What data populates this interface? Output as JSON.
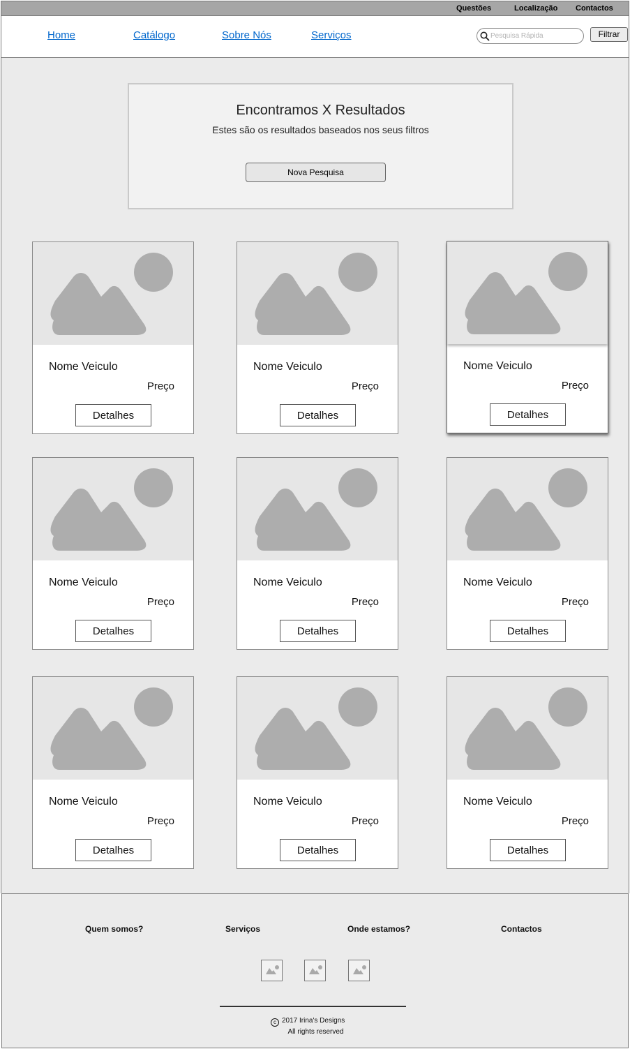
{
  "utility_nav": [
    "Questões",
    "Localização",
    "Contactos"
  ],
  "main_nav": [
    "Home",
    "Catálogo",
    "Sobre Nós",
    "Serviços"
  ],
  "search": {
    "placeholder": "Pesquisa Rápida",
    "button": "Filtrar"
  },
  "results": {
    "title": "Encontramos X Resultados",
    "subtitle": "Estes são os resultados baseados nos seus filtros",
    "button": "Nova Pesquisa"
  },
  "cards": [
    {
      "name": "Nome Veiculo",
      "price": "Preço",
      "button": "Detalhes"
    },
    {
      "name": "Nome Veiculo",
      "price": "Preço",
      "button": "Detalhes"
    },
    {
      "name": "Nome Veiculo",
      "price": "Preço",
      "button": "Detalhes"
    },
    {
      "name": "Nome Veiculo",
      "price": "Preço",
      "button": "Detalhes"
    },
    {
      "name": "Nome Veiculo",
      "price": "Preço",
      "button": "Detalhes"
    },
    {
      "name": "Nome Veiculo",
      "price": "Preço",
      "button": "Detalhes"
    },
    {
      "name": "Nome Veiculo",
      "price": "Preço",
      "button": "Detalhes"
    },
    {
      "name": "Nome Veiculo",
      "price": "Preço",
      "button": "Detalhes"
    },
    {
      "name": "Nome Veiculo",
      "price": "Preço",
      "button": "Detalhes"
    }
  ],
  "footer": {
    "columns": [
      "Quem somos?",
      "Serviços",
      "Onde estamos?",
      "Contactos"
    ],
    "social_icons": [
      "image-icon",
      "image-icon",
      "image-icon"
    ],
    "copyright_symbol": "c",
    "copyright": "2017 Irina's Designs",
    "rights": "All rights reserved"
  },
  "colors": {
    "link": "#0066cc",
    "topbar": "#a6a6a6",
    "page_background": "#ebebeb",
    "placeholder_image": "#e6e6e6",
    "placeholder_shape": "#adadad"
  }
}
